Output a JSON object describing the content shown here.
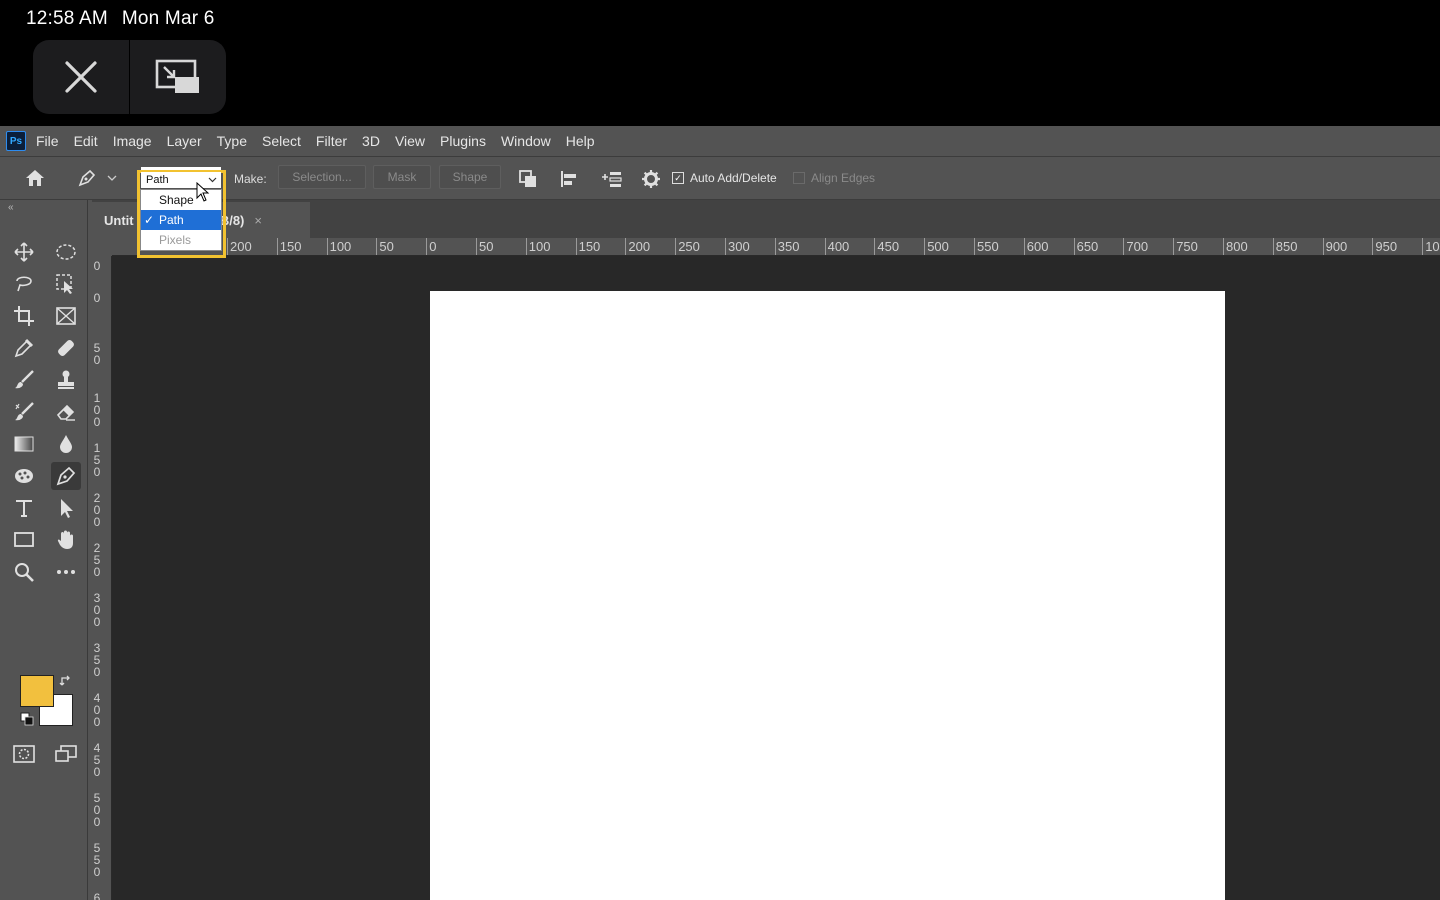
{
  "device": {
    "time": "12:58 AM",
    "date": "Mon Mar 6"
  },
  "app": {
    "logo": "Ps",
    "menu": [
      "File",
      "Edit",
      "Image",
      "Layer",
      "Type",
      "Select",
      "Filter",
      "3D",
      "View",
      "Plugins",
      "Window",
      "Help"
    ]
  },
  "options": {
    "mode_value": "Path",
    "make_label": "Make:",
    "selection_label": "Selection...",
    "mask_label": "Mask",
    "shape_label": "Shape",
    "auto_add_delete": "Auto Add/Delete",
    "auto_add_delete_checked": true,
    "align_edges": "Align Edges",
    "align_edges_checked": false
  },
  "mode_dropdown": {
    "options": [
      "Shape",
      "Path",
      "Pixels"
    ],
    "selected": "Path",
    "disabled": [
      "Pixels"
    ]
  },
  "document": {
    "tab_title_start": "Untit",
    "tab_title_end": "(RGB/8)",
    "close_glyph": "×"
  },
  "ruler": {
    "top_labels": [
      "200",
      "150",
      "100",
      "50",
      "0",
      "50",
      "100",
      "150",
      "200",
      "250",
      "300",
      "350",
      "400",
      "450",
      "500",
      "550",
      "600",
      "650",
      "700",
      "750",
      "800",
      "850",
      "900",
      "950",
      "10"
    ],
    "left_labels": [
      "0",
      "0",
      "5\n0",
      "1\n0\n0",
      "1\n5\n0",
      "2\n0\n0",
      "2\n5\n0",
      "3\n0\n0",
      "3\n5\n0",
      "4\n0\n0",
      "4\n5\n0",
      "5\n0\n0",
      "5\n5\n0",
      "6"
    ]
  },
  "colors": {
    "foreground": "#f2c03e",
    "background": "#ffffff",
    "highlight": "#f2c230",
    "selection_blue": "#1f6fd6"
  },
  "tools": [
    "move-icon",
    "marquee-icon",
    "lasso-icon",
    "object-select-icon",
    "crop-icon",
    "frame-icon",
    "eyedropper-icon",
    "healing-icon",
    "brush-icon",
    "stamp-icon",
    "history-brush-icon",
    "eraser-icon",
    "gradient-icon",
    "blur-icon",
    "dodge-icon",
    "pen-icon",
    "type-icon",
    "path-select-icon",
    "rectangle-icon",
    "hand-icon",
    "zoom-icon",
    "more-icon"
  ]
}
